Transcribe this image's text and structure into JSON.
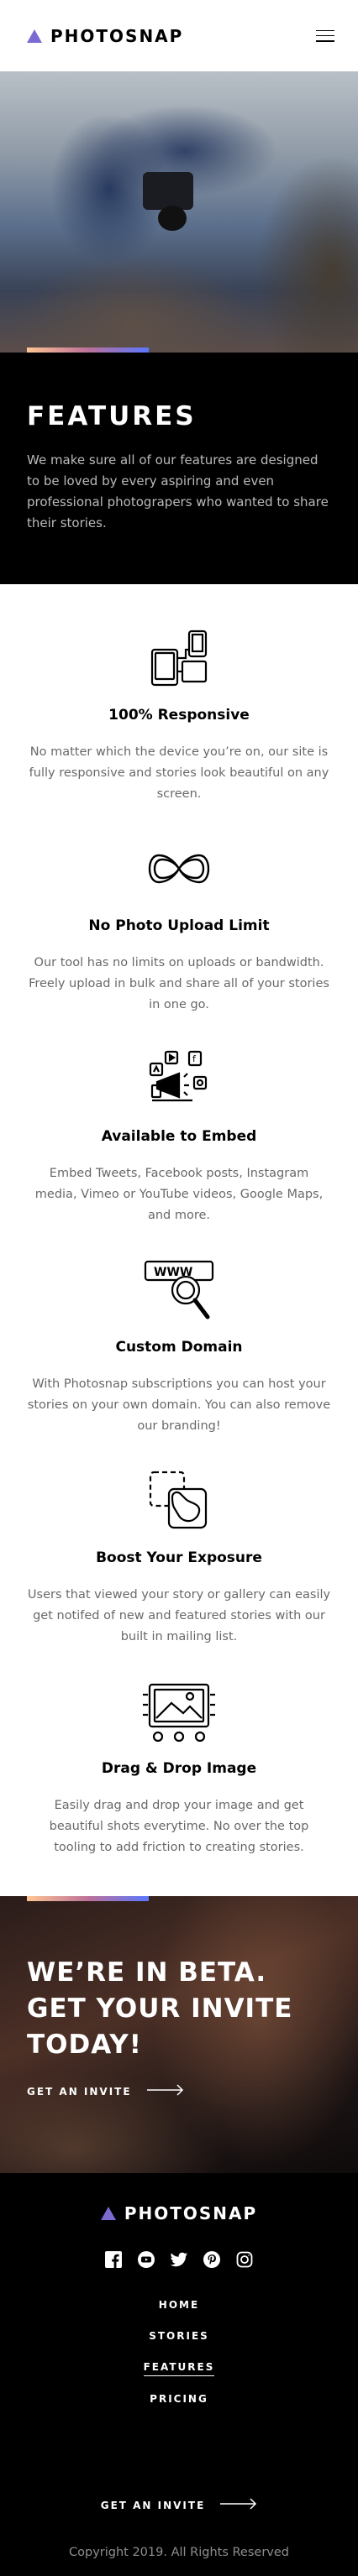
{
  "brand": {
    "name": "PHOTOSNAP",
    "accent_gradient": [
      "#ffc593",
      "#bc7198",
      "#5a77ff"
    ],
    "logo_color": "#7b6ad1"
  },
  "header": {
    "menu_icon": "hamburger-icon"
  },
  "intro": {
    "title": "FEATURES",
    "body": "We make sure all of our features are designed to be loved by every aspiring and even professional photograpers who wanted to share their stories."
  },
  "features": [
    {
      "icon": "responsive-icon",
      "title": "100% Responsive",
      "body": "No matter which the device you’re on, our site is fully responsive and stories look beautiful on any screen."
    },
    {
      "icon": "infinity-icon",
      "title": "No Photo Upload Limit",
      "body": "Our tool has no limits on uploads or bandwidth. Freely upload in bulk and share all of your stories in one go."
    },
    {
      "icon": "embed-icon",
      "title": "Available to Embed",
      "body": "Embed Tweets, Facebook posts, Instagram media, Vimeo or YouTube videos, Google Maps, and more."
    },
    {
      "icon": "custom-domain-icon",
      "title": "Custom Domain",
      "body": "With Photosnap subscriptions you can host your stories on your own domain. You can also remove our branding!"
    },
    {
      "icon": "boost-exposure-icon",
      "title": "Boost Your Exposure",
      "body": "Users that viewed your story or gallery can easily get notifed of new and featured stories with our built in mailing list."
    },
    {
      "icon": "drag-drop-icon",
      "title": "Drag & Drop Image",
      "body": "Easily drag and drop your image and get beautiful shots everytime. No over the top tooling to add friction to creating stories."
    }
  ],
  "beta": {
    "line1": "WE’RE IN BETA.",
    "line2": "GET YOUR INVITE",
    "line3": "TODAY!",
    "cta": "GET AN INVITE"
  },
  "footer": {
    "social": [
      "facebook-icon",
      "youtube-icon",
      "twitter-icon",
      "pinterest-icon",
      "instagram-icon"
    ],
    "nav": [
      "HOME",
      "STORIES",
      "FEATURES",
      "PRICING"
    ],
    "active_nav": "FEATURES",
    "cta": "GET AN INVITE",
    "copyright": "Copyright 2019. All Rights Reserved"
  }
}
